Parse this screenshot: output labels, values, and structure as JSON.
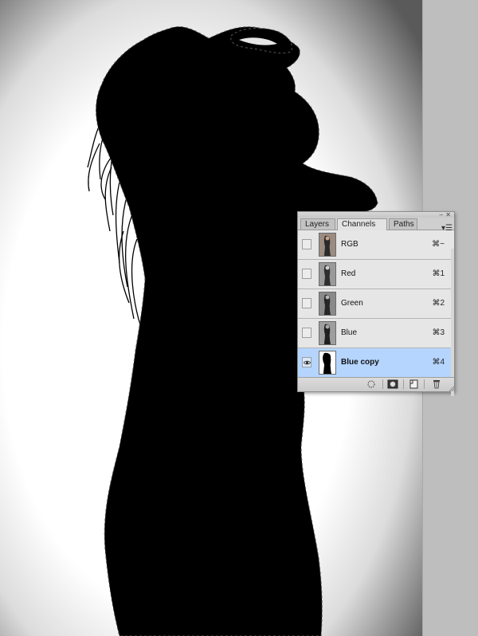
{
  "panel": {
    "tabs": [
      {
        "label": "Layers",
        "active": false
      },
      {
        "label": "Channels",
        "active": true,
        "close": "✕"
      },
      {
        "label": "Paths",
        "active": false
      }
    ],
    "controls": {
      "minimize": "‒",
      "close": "✕",
      "menu": "▾☰"
    },
    "channels": [
      {
        "label": "RGB",
        "shortcut": "⌘~",
        "visible": false,
        "selected": false
      },
      {
        "label": "Red",
        "shortcut": "⌘1",
        "visible": false,
        "selected": false
      },
      {
        "label": "Green",
        "shortcut": "⌘2",
        "visible": false,
        "selected": false
      },
      {
        "label": "Blue",
        "shortcut": "⌘3",
        "visible": false,
        "selected": false
      },
      {
        "label": "Blue copy",
        "shortcut": "⌘4",
        "visible": true,
        "selected": true
      }
    ],
    "footer_buttons": [
      {
        "name": "load-channel-as-selection-icon"
      },
      {
        "name": "save-selection-as-channel-icon"
      },
      {
        "name": "new-channel-icon"
      },
      {
        "name": "delete-channel-icon"
      }
    ]
  },
  "colors": {
    "selected_row": "#b5d5ff",
    "silhouette": "#000000",
    "canvas_background": "#ffffff",
    "workspace_gray": "#bdbdbd"
  }
}
